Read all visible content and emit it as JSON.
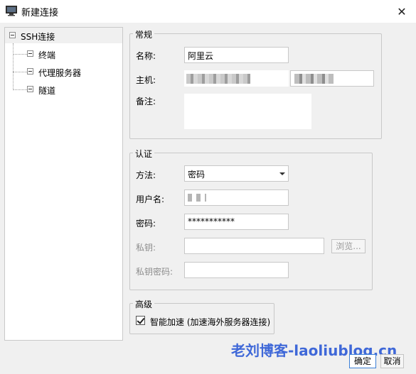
{
  "window": {
    "title": "新建连接",
    "close_glyph": "✕"
  },
  "tree": {
    "root": {
      "label": "SSH连接"
    },
    "children": [
      {
        "label": "终端"
      },
      {
        "label": "代理服务器"
      },
      {
        "label": "隧道"
      }
    ]
  },
  "general": {
    "title": "常规",
    "name_label": "名称:",
    "name_value": "阿里云",
    "host_label": "主机:",
    "remark_label": "备注:"
  },
  "auth": {
    "title": "认证",
    "method_label": "方法:",
    "method_value": "密码",
    "username_label": "用户名:",
    "password_label": "密码:",
    "password_value": "***********",
    "key_label": "私钥:",
    "browse_label": "浏览...",
    "key_password_label": "私钥密码:"
  },
  "advanced": {
    "title": "高级",
    "accelerate_label": "智能加速 (加速海外服务器连接)",
    "accelerate_checked": true
  },
  "footer": {
    "watermark": "老刘博客-laoliublog.cn",
    "ok_label": "确定",
    "cancel_label": "取消"
  },
  "icons": {
    "app": "terminal-window-icon",
    "close": "close-icon",
    "expander": "minus-box-icon",
    "check": "checkmark-icon"
  }
}
